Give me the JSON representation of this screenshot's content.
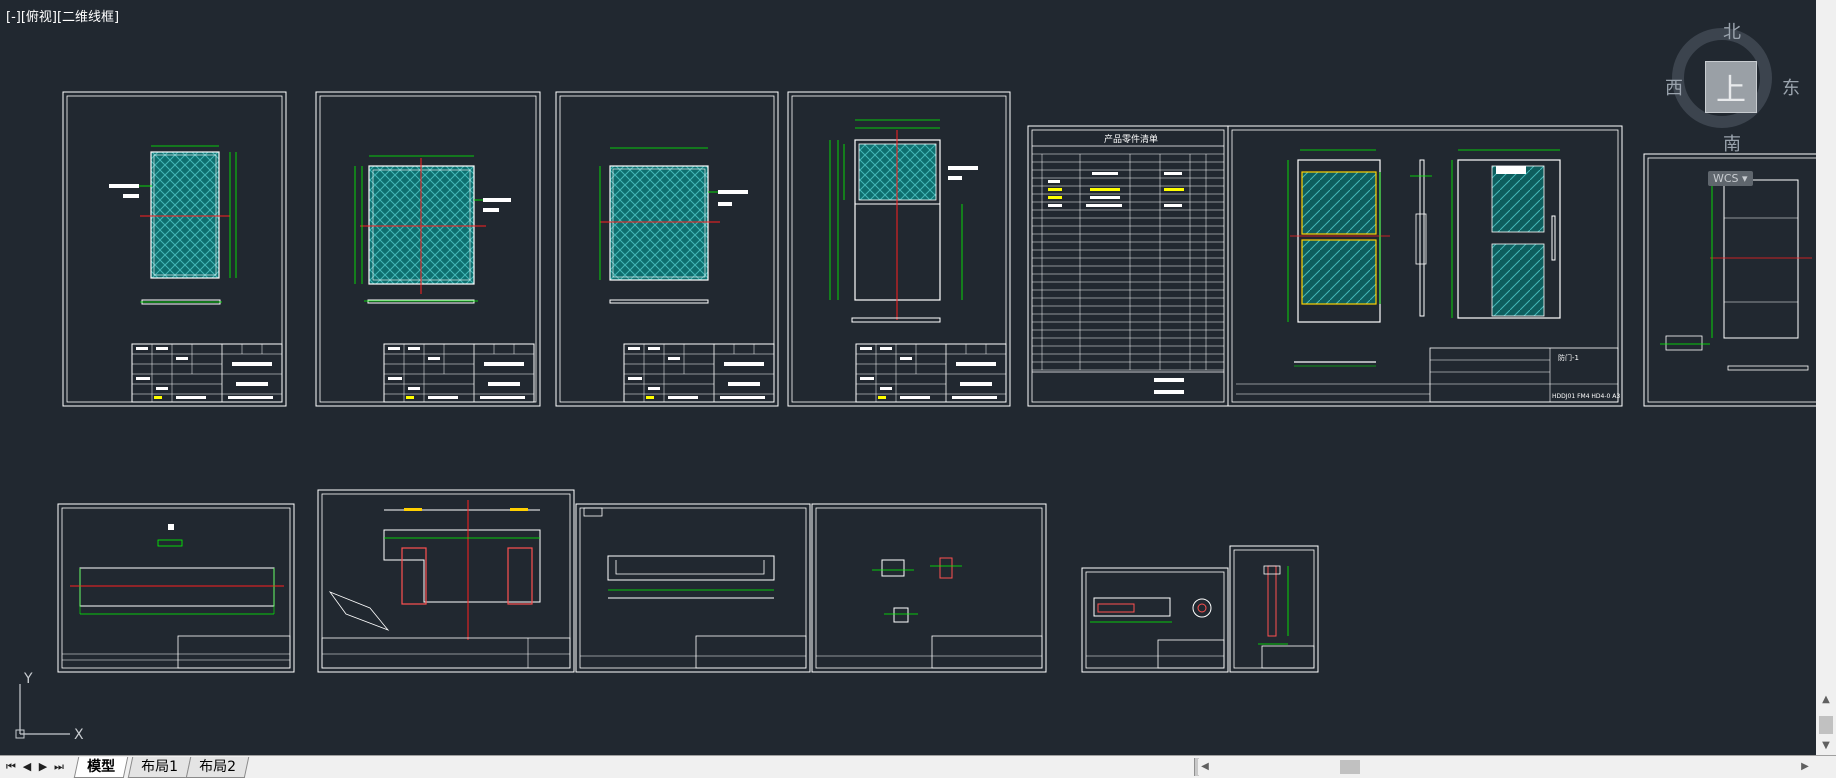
{
  "viewport": {
    "label": "[-][俯视][二维线框]"
  },
  "viewcube": {
    "north": "北",
    "south": "南",
    "west": "西",
    "east": "东",
    "face": "上",
    "wcs_label": "WCS"
  },
  "ucs": {
    "x_label": "X",
    "y_label": "Y"
  },
  "tabs": [
    {
      "label": "模型",
      "active": true
    },
    {
      "label": "布局1",
      "active": false
    },
    {
      "label": "布局2",
      "active": false
    }
  ],
  "sheets": {
    "parts_list_title": "产品零件清单",
    "door_label": "防门-1",
    "drawing_number": "HDDJ01 FM4 HD4-0 A3"
  },
  "colors": {
    "background": "#212830",
    "frame": "#ffffff",
    "dimension": "#00ff00",
    "centerline": "#ff0000",
    "glass_fill": "#0e6f6f",
    "highlight": "#ffff00",
    "part": "#ff5050"
  }
}
